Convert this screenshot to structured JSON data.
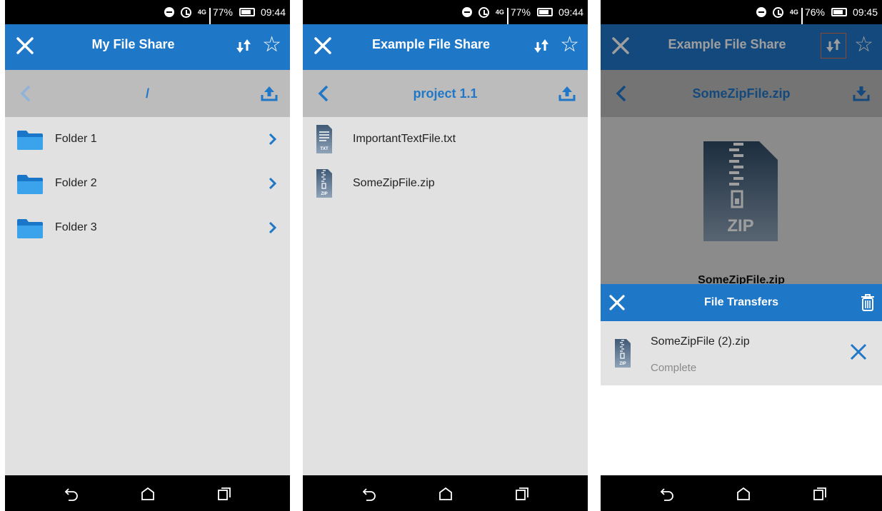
{
  "screens": [
    {
      "status": {
        "battery_pct": "77%",
        "time": "09:44",
        "net": "4G"
      },
      "title": "My File Share",
      "path": "/",
      "items": [
        {
          "label": "Folder 1",
          "kind": "folder-icon"
        },
        {
          "label": "Folder 2",
          "kind": "folder-icon"
        },
        {
          "label": "Folder 3",
          "kind": "folder-icon"
        }
      ]
    },
    {
      "status": {
        "battery_pct": "77%",
        "time": "09:44",
        "net": "4G"
      },
      "title": "Example File Share",
      "path": "project 1.1",
      "items": [
        {
          "label": "ImportantTextFile.txt",
          "kind": "txt-file-icon",
          "badge": "TXT"
        },
        {
          "label": "SomeZipFile.zip",
          "kind": "zip-file-icon",
          "badge": "ZIP"
        }
      ]
    },
    {
      "status": {
        "battery_pct": "76%",
        "time": "09:45",
        "net": "4G"
      },
      "title": "Example File Share",
      "path": "SomeZipFile.zip",
      "preview": {
        "badge": "ZIP",
        "name": "SomeZipFile.zip"
      },
      "transfers": {
        "title": "File Transfers",
        "items": [
          {
            "name": "SomeZipFile (2).zip",
            "status": "Complete",
            "badge": "ZIP"
          }
        ]
      }
    }
  ],
  "colors": {
    "primary": "#1f77c8",
    "path_bar": "#bcbcbc",
    "background": "#e1e1e1",
    "status_bar": "#000000"
  }
}
